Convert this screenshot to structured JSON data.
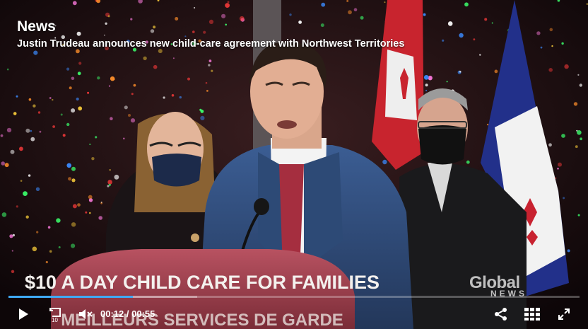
{
  "overlay": {
    "channel": "News",
    "headline": "Justin Trudeau announces new child-care agreement with Northwest Territories"
  },
  "podium": {
    "line1": "$10 A DAY CHILD CARE FOR FAMILIES",
    "line2": "MEILLEURS SERVICES DE GARDE"
  },
  "watermark": {
    "main": "Global",
    "sub": "NEWS"
  },
  "player": {
    "current_time": "00:12",
    "separator": "/",
    "duration": "00:55",
    "progress_fraction": 0.218,
    "buffered_fraction": 0.33,
    "accent": "#3fa9f5",
    "icons": [
      "play-icon",
      "replay-10-icon",
      "mute-icon",
      "share-icon",
      "grid-icon",
      "fullscreen-icon"
    ]
  }
}
